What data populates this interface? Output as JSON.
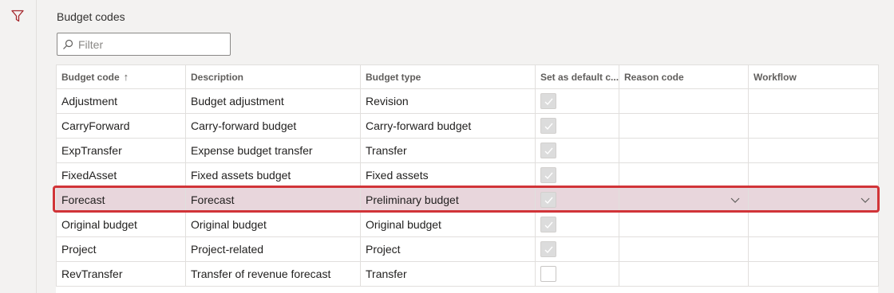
{
  "page": {
    "title": "Budget codes"
  },
  "filter": {
    "placeholder": "Filter"
  },
  "grid": {
    "columns": [
      {
        "label": "Budget code",
        "sort_indicator": "↑"
      },
      {
        "label": "Description"
      },
      {
        "label": "Budget type"
      },
      {
        "label": "Set as default c..."
      },
      {
        "label": "Reason code"
      },
      {
        "label": "Workflow"
      }
    ],
    "rows": [
      {
        "code": "Adjustment",
        "description": "Budget adjustment",
        "type": "Revision",
        "default_checked": true,
        "reason": "",
        "workflow": ""
      },
      {
        "code": "CarryForward",
        "description": "Carry-forward budget",
        "type": "Carry-forward budget",
        "default_checked": true,
        "reason": "",
        "workflow": ""
      },
      {
        "code": "ExpTransfer",
        "description": "Expense budget transfer",
        "type": "Transfer",
        "default_checked": true,
        "reason": "",
        "workflow": ""
      },
      {
        "code": "FixedAsset",
        "description": "Fixed assets budget",
        "type": "Fixed assets",
        "default_checked": true,
        "reason": "",
        "workflow": ""
      },
      {
        "code": "Forecast",
        "description": "Forecast",
        "type": "Preliminary budget",
        "default_checked": true,
        "reason": "",
        "workflow": "",
        "selected": true
      },
      {
        "code": "Original budget",
        "description": "Original budget",
        "type": "Original budget",
        "default_checked": true,
        "reason": "",
        "workflow": ""
      },
      {
        "code": "Project",
        "description": "Project-related",
        "type": "Project",
        "default_checked": true,
        "reason": "",
        "workflow": ""
      },
      {
        "code": "RevTransfer",
        "description": "Transfer of revenue forecast",
        "type": "Transfer",
        "default_checked": false,
        "reason": "",
        "workflow": ""
      }
    ]
  },
  "icons": {
    "filter_pane": "funnel-icon",
    "search": "search-icon",
    "dropdown": "chevron-down-icon",
    "check": "checkmark-icon"
  },
  "colors": {
    "selected_row": "#e8d6dc",
    "highlight_border": "#d13438",
    "filter_icon": "#a4262c"
  }
}
